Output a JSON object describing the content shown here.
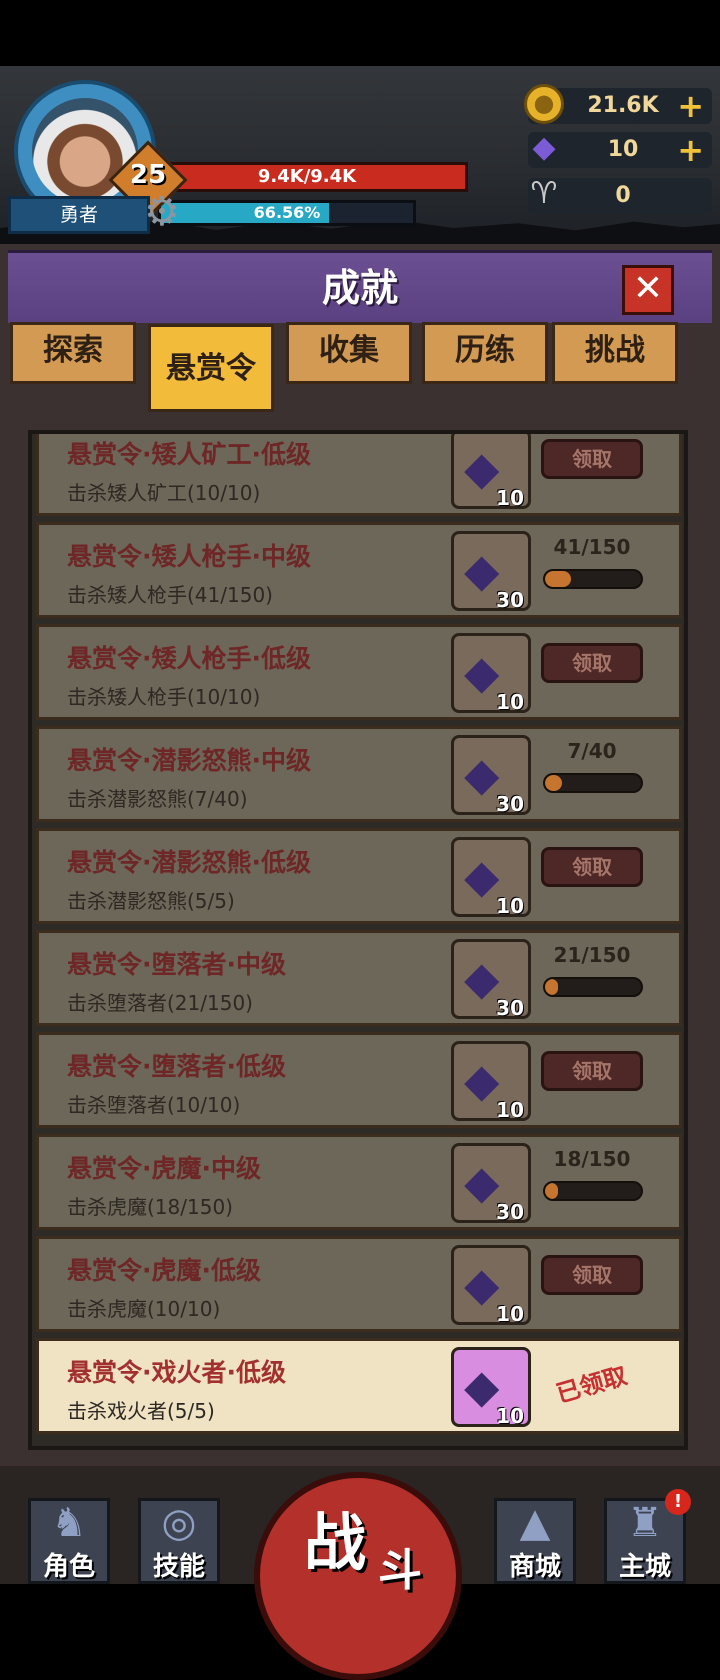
{
  "player": {
    "name": "勇者",
    "level": "25",
    "hp": "9.4K/9.4K",
    "xp_text": "66.56%",
    "xp_fraction": 0.6656
  },
  "resources": {
    "coins": "21.6K",
    "gems": "10",
    "horns": "0"
  },
  "panel": {
    "title": "成就",
    "close_glyph": "✕"
  },
  "tabs": [
    {
      "label": "探索"
    },
    {
      "label": "悬赏令"
    },
    {
      "label": "收集"
    },
    {
      "label": "历练"
    },
    {
      "label": "挑战"
    }
  ],
  "active_tab": "悬赏令",
  "bounties": [
    {
      "title": "悬赏令·矮人矿工·低级",
      "desc": "击杀矮人矿工(10/10)",
      "reward": "10",
      "status": "claim",
      "claim_label": "领取"
    },
    {
      "title": "悬赏令·矮人枪手·中级",
      "desc": "击杀矮人枪手(41/150)",
      "reward": "30",
      "status": "progress",
      "progress_text": "41/150",
      "progress": 0.273
    },
    {
      "title": "悬赏令·矮人枪手·低级",
      "desc": "击杀矮人枪手(10/10)",
      "reward": "10",
      "status": "claim",
      "claim_label": "领取"
    },
    {
      "title": "悬赏令·潜影怒熊·中级",
      "desc": "击杀潜影怒熊(7/40)",
      "reward": "30",
      "status": "progress",
      "progress_text": "7/40",
      "progress": 0.175
    },
    {
      "title": "悬赏令·潜影怒熊·低级",
      "desc": "击杀潜影怒熊(5/5)",
      "reward": "10",
      "status": "claim",
      "claim_label": "领取"
    },
    {
      "title": "悬赏令·堕落者·中级",
      "desc": "击杀堕落者(21/150)",
      "reward": "30",
      "status": "progress",
      "progress_text": "21/150",
      "progress": 0.14
    },
    {
      "title": "悬赏令·堕落者·低级",
      "desc": "击杀堕落者(10/10)",
      "reward": "10",
      "status": "claim",
      "claim_label": "领取"
    },
    {
      "title": "悬赏令·虎魔·中级",
      "desc": "击杀虎魔(18/150)",
      "reward": "30",
      "status": "progress",
      "progress_text": "18/150",
      "progress": 0.12
    },
    {
      "title": "悬赏令·虎魔·低级",
      "desc": "击杀虎魔(10/10)",
      "reward": "10",
      "status": "claim",
      "claim_label": "领取"
    },
    {
      "title": "悬赏令·戏火者·低级",
      "desc": "击杀戏火者(5/5)",
      "reward": "10",
      "status": "claimed",
      "claimed_label": "已领取"
    }
  ],
  "nav": {
    "character": "角色",
    "skills": "技能",
    "battle_1": "战",
    "battle_2": "斗",
    "shop": "商城",
    "main_city": "主城",
    "main_city_alert": "!"
  },
  "colors": {
    "hp": "#c92b1e",
    "xp": "#27a9c6",
    "header": "#6b4f93",
    "tab_active": "#f2bb3a",
    "tab": "#d29a52",
    "title_text": "#6e2626"
  }
}
